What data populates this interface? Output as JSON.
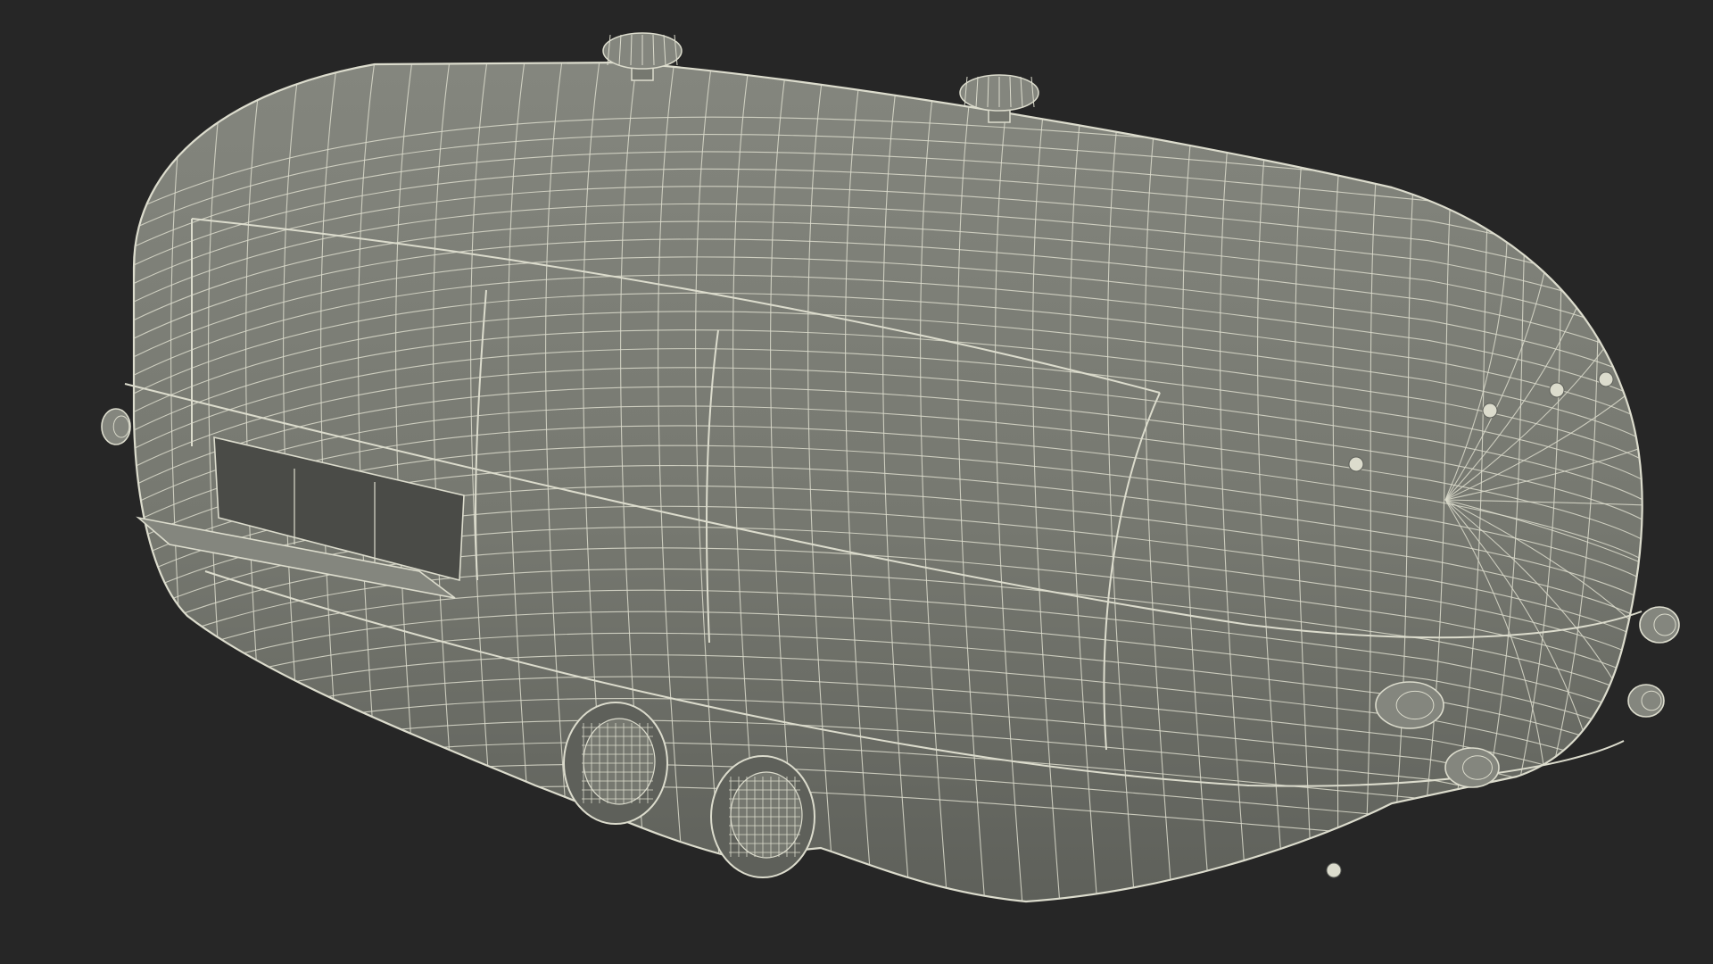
{
  "scene": {
    "subject": "wireframe-trailer",
    "colors": {
      "background": "#262626",
      "body_fill": "#767870",
      "body_fill_dark": "#5e605a",
      "body_fill_light": "#84867e",
      "wire": "#dcdccd",
      "interior": "#4a4b47",
      "shadow": "#1c1c1c"
    },
    "icons": [
      "roof-vent-icon",
      "tail-light-icon",
      "wheel-icon"
    ]
  }
}
